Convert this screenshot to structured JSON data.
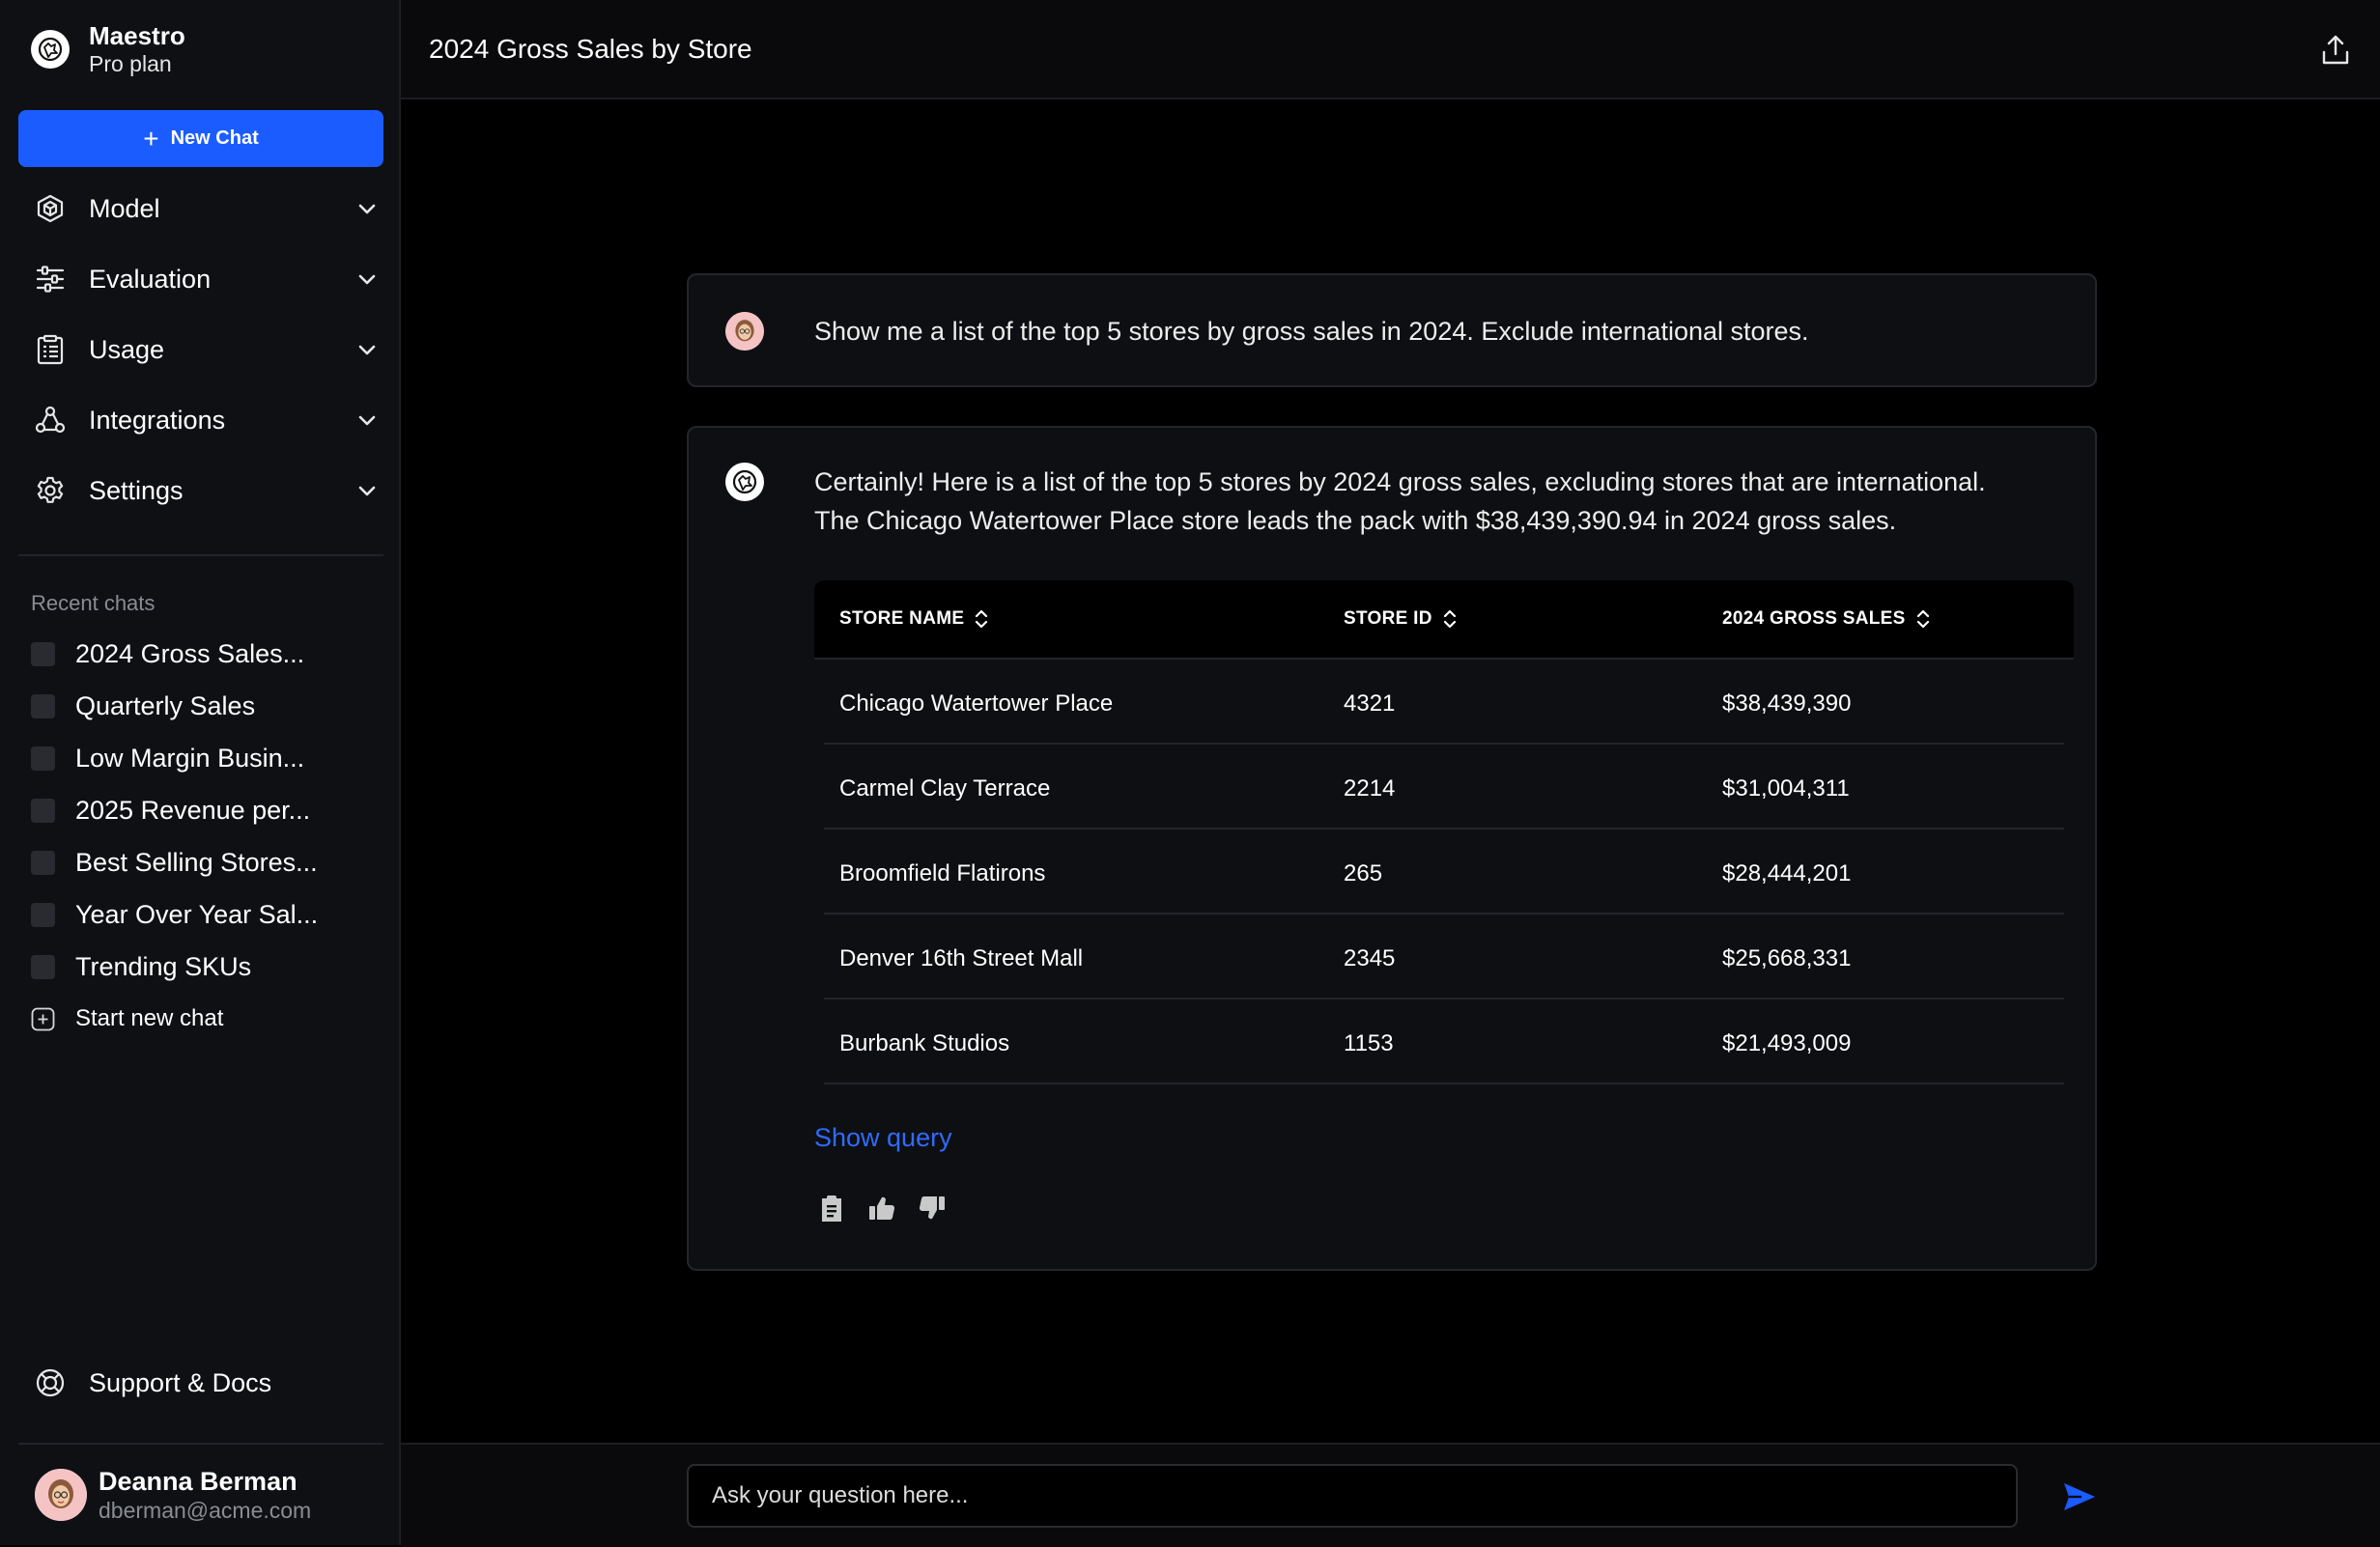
{
  "brand": {
    "name": "Maestro",
    "plan": "Pro plan"
  },
  "sidebar": {
    "new_chat_label": "New Chat",
    "nav": [
      {
        "label": "Model",
        "icon": "cube-icon"
      },
      {
        "label": "Evaluation",
        "icon": "sliders-icon"
      },
      {
        "label": "Usage",
        "icon": "clipboard-list-icon"
      },
      {
        "label": "Integrations",
        "icon": "integrations-icon"
      },
      {
        "label": "Settings",
        "icon": "gear-icon"
      }
    ],
    "recent_title": "Recent chats",
    "recent": [
      "2024 Gross Sales...",
      "Quarterly Sales",
      "Low Margin Busin...",
      "2025 Revenue per...",
      "Best Selling Stores...",
      "Year Over Year Sal...",
      "Trending SKUs"
    ],
    "start_new_chat": "Start new chat",
    "support_label": "Support & Docs"
  },
  "user": {
    "name": "Deanna Berman",
    "email": "dberman@acme.com"
  },
  "header": {
    "title": "2024 Gross Sales by Store"
  },
  "conversation": {
    "user_message": "Show me a list of the top 5 stores by gross sales in 2024. Exclude international stores.",
    "ai_message_line1": "Certainly! Here is a list of the top 5 stores by 2024 gross sales, excluding stores that are international.",
    "ai_message_line2": "The Chicago Watertower Place store leads the pack with $38,439,390.94 in 2024 gross sales.",
    "table": {
      "headers": [
        "STORE NAME",
        "STORE ID",
        "2024 GROSS SALES"
      ],
      "rows": [
        [
          "Chicago Watertower Place",
          "4321",
          "$38,439,390"
        ],
        [
          "Carmel Clay Terrace",
          "2214",
          "$31,004,311"
        ],
        [
          "Broomfield Flatirons",
          "265",
          "$28,444,201"
        ],
        [
          "Denver 16th Street Mall",
          "2345",
          "$25,668,331"
        ],
        [
          "Burbank Studios",
          "1153",
          "$21,493,009"
        ]
      ]
    },
    "show_query": "Show query"
  },
  "composer": {
    "placeholder": "Ask your question here..."
  },
  "colors": {
    "accent": "#1a5cff",
    "link": "#2f6bff",
    "sidebar_bg": "#0f1014"
  }
}
